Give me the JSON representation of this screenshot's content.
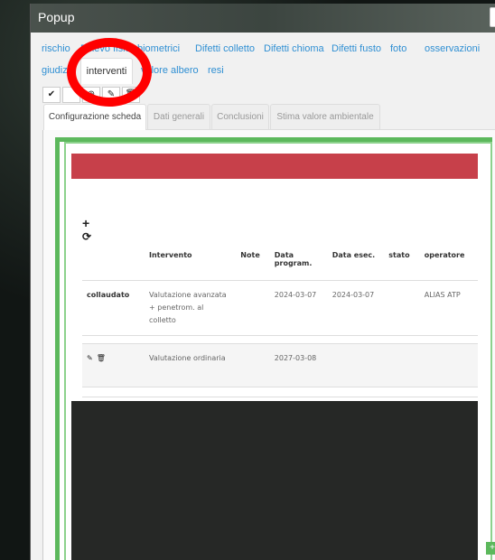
{
  "window": {
    "title": "Popup"
  },
  "tabs_row1": [
    {
      "label": "rischio"
    },
    {
      "label": "Rilievo fisico"
    },
    {
      "label": "biometrici"
    },
    {
      "label": "Difetti colletto"
    },
    {
      "label": "Difetti chioma"
    },
    {
      "label": "Difetti fusto"
    },
    {
      "label": "foto"
    },
    {
      "label": "osservazioni"
    }
  ],
  "tabs_row2": [
    {
      "label": "giudizio"
    },
    {
      "label": "interventi"
    },
    {
      "label": "valore albero"
    },
    {
      "label": "resi"
    }
  ],
  "toolbar": {
    "save_icon": "check-icon",
    "zoom_icon": "zoom-in-icon",
    "edit_icon": "pencil-icon",
    "delete_icon": "trash-icon"
  },
  "subtabs": [
    {
      "label": "Configurazione scheda"
    },
    {
      "label": "Dati generali"
    },
    {
      "label": "Conclusioni"
    },
    {
      "label": "Stima valore ambientale"
    }
  ],
  "table": {
    "headers": [
      "",
      "Intervento",
      "Note",
      "Data program.",
      "Data esec.",
      "stato",
      "operatore"
    ],
    "rows": [
      {
        "tag": "collaudato",
        "intervento": "Valutazione avanzata + penetrom. al colletto",
        "note": "",
        "data_program": "2024-03-07",
        "data_esec": "2024-03-07",
        "stato": "",
        "operatore": "ALIAS ATP"
      },
      {
        "tag": "",
        "intervento": "Valutazione ordinaria",
        "note": "",
        "data_program": "2027-03-08",
        "data_esec": "",
        "stato": "",
        "operatore": ""
      }
    ]
  },
  "colors": {
    "accent_red": "#c7404a",
    "frame_green": "#5cb85c",
    "link_blue": "#2f8fd3",
    "annotation_red": "#ff0000"
  }
}
